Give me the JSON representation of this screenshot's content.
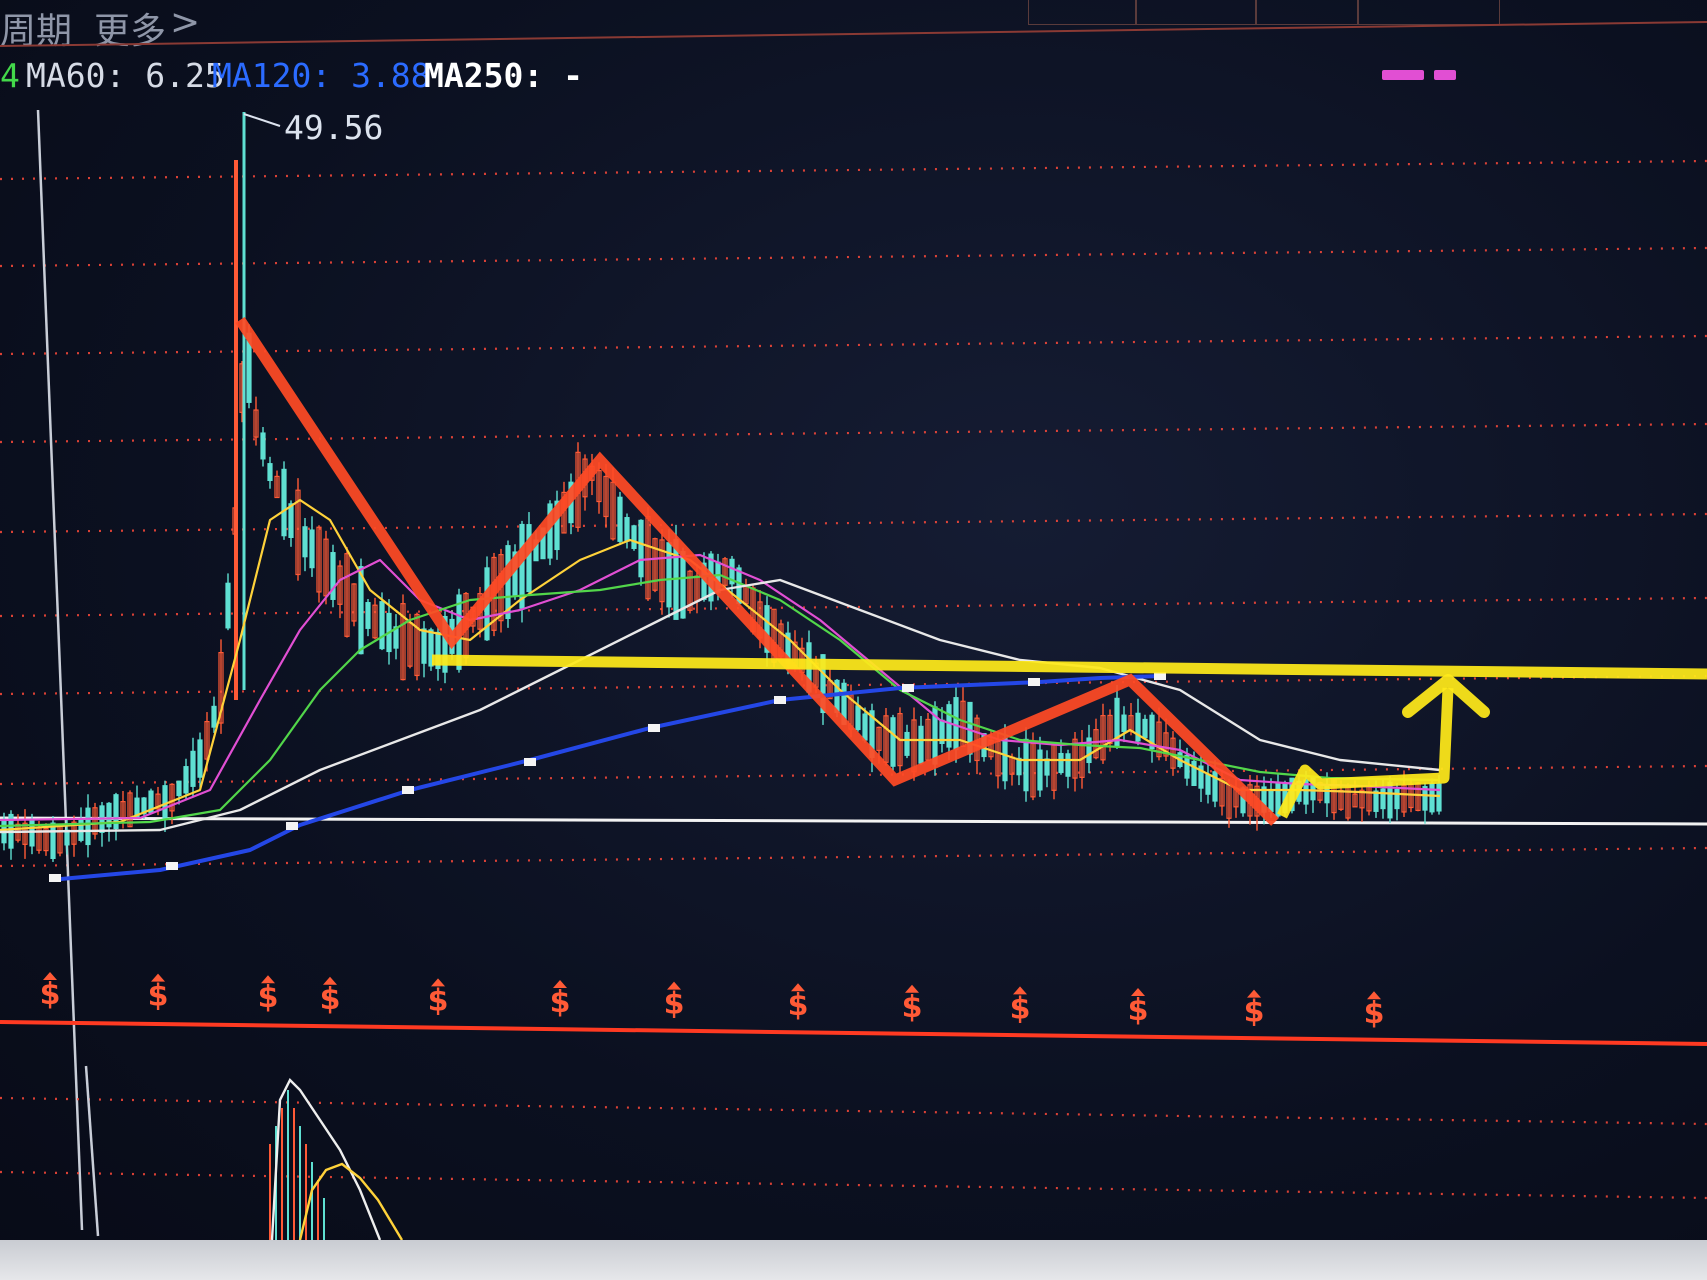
{
  "header": {
    "period_label": "周期",
    "more_label": "更多",
    "more_chevron": ">"
  },
  "indicators": {
    "green_fragment": "4",
    "ma60": "MA60: 6.25",
    "ma120": "MA120: 3.88",
    "ma250": "MA250: -"
  },
  "high_marker": "49.56",
  "colors": {
    "up_candle": "#ff5a36",
    "down_candle": "#5fe0d2",
    "ma_yellow": "#ffd23a",
    "ma_magenta": "#e14fd3",
    "ma_green": "#52d64a",
    "ma_white": "#e8e8e8",
    "ma_blue": "#2447e6",
    "annotation_red": "#ff4a25",
    "annotation_yellow": "#ffea1a",
    "grid_dots": "#ff4a3a",
    "panel_divider": "#ff3a22"
  },
  "chart_data": {
    "type": "candlestick",
    "y_axis": {
      "shown": false
    },
    "grid": "horizontal-dotted",
    "price_peak": 49.56,
    "moving_averages": [
      {
        "name": "MA60",
        "value": 6.25
      },
      {
        "name": "MA120",
        "value": 3.88
      },
      {
        "name": "MA250",
        "value": null
      }
    ],
    "annotations": [
      {
        "type": "zigzag",
        "color": "red"
      },
      {
        "type": "support-line",
        "color": "yellow"
      },
      {
        "type": "up-arrow",
        "color": "yellow"
      }
    ],
    "event_markers": {
      "symbol": "$",
      "count": 13
    },
    "lower_panel": {
      "type": "indicator"
    }
  }
}
